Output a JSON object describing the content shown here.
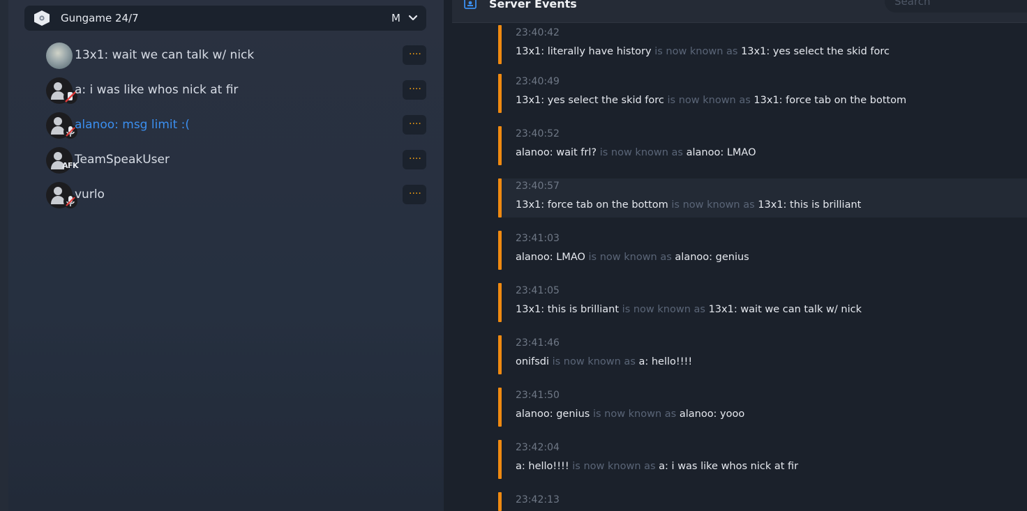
{
  "colors": {
    "accent": "#f08a11",
    "highlight_name": "#3b8ff0",
    "muted_text": "#5a6577"
  },
  "server": {
    "name": "Gungame 24/7",
    "initial": "M",
    "icon": "server-shield-icon",
    "chevron_icon": "chevron-down-icon"
  },
  "clients": [
    {
      "name": "13x1: wait we can talk w/ nick",
      "avatar": "photo",
      "status": "none"
    },
    {
      "name": "a: i was like whos nick at fir",
      "avatar": "default",
      "status": "muted"
    },
    {
      "name": "alanoo: msg limit :(",
      "avatar": "default",
      "status": "mic-muted",
      "highlighted": true
    },
    {
      "name": "TeamSpeakUser",
      "avatar": "default",
      "status": "afk",
      "afk_label": "AFK"
    },
    {
      "name": "vurlo",
      "avatar": "default",
      "status": "mic-muted"
    }
  ],
  "more_label": "····",
  "events_panel": {
    "title": "Server Events",
    "search_placeholder": "Search",
    "icon": "server-events-icon"
  },
  "connector": "is now known as",
  "events": [
    {
      "time": "23:40:42",
      "old": "13x1: literally have history",
      "new": "13x1: yes select the skid forc"
    },
    {
      "time": "23:40:49",
      "old": "13x1: yes select the skid forc",
      "new": "13x1: force tab on the bottom"
    },
    {
      "time": "23:40:52",
      "old": "alanoo: wait frl?",
      "new": "alanoo: LMAO"
    },
    {
      "time": "23:40:57",
      "old": "13x1: force tab on the bottom",
      "new": "13x1: this is brilliant"
    },
    {
      "time": "23:41:03",
      "old": "alanoo: LMAO",
      "new": "alanoo: genius"
    },
    {
      "time": "23:41:05",
      "old": "13x1: this is brilliant",
      "new": "13x1: wait we can talk w/ nick"
    },
    {
      "time": "23:41:46",
      "old": "onifsdi",
      "new": "a: hello!!!!"
    },
    {
      "time": "23:41:50",
      "old": "alanoo: genius",
      "new": "alanoo: yooo"
    },
    {
      "time": "23:42:04",
      "old": "a: hello!!!!",
      "new": "a: i was like whos nick at fir"
    },
    {
      "time": "23:42:13",
      "old": "",
      "new": ""
    }
  ]
}
